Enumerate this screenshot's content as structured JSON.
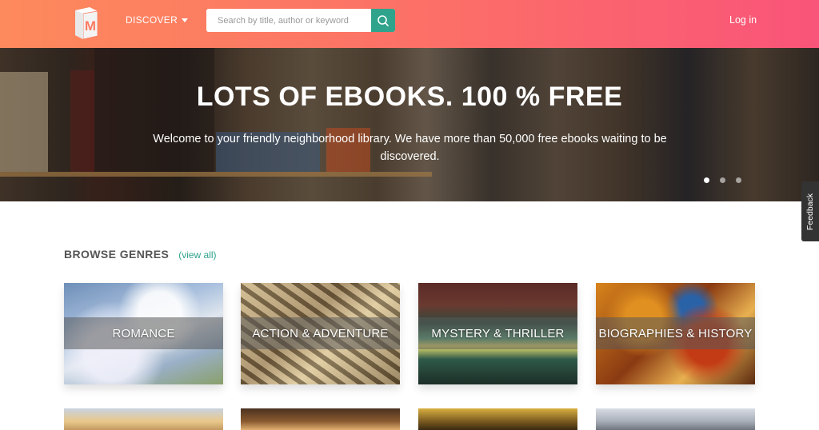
{
  "header": {
    "logo_letter": "M",
    "discover_label": "DISCOVER",
    "search_placeholder": "Search by title, author or keyword",
    "login_label": "Log in"
  },
  "hero": {
    "title": "LOTS OF EBOOKS. 100 % FREE",
    "subtitle": "Welcome to your friendly neighborhood library. We have more than 50,000 free ebooks waiting to be discovered.",
    "slide_count": 3,
    "active_slide": 1
  },
  "feedback_label": "Feedback",
  "genres": {
    "title": "BROWSE GENRES",
    "view_all": "(view all)",
    "tiles": [
      {
        "label": "ROMANCE"
      },
      {
        "label": "ACTION & ADVENTURE"
      },
      {
        "label": "MYSTERY & THRILLER"
      },
      {
        "label": "BIOGRAPHIES & HISTORY"
      }
    ]
  },
  "colors": {
    "header_gradient_start": "#fd8a5c",
    "header_gradient_end": "#f95479",
    "accent_teal": "#2fa38c"
  }
}
